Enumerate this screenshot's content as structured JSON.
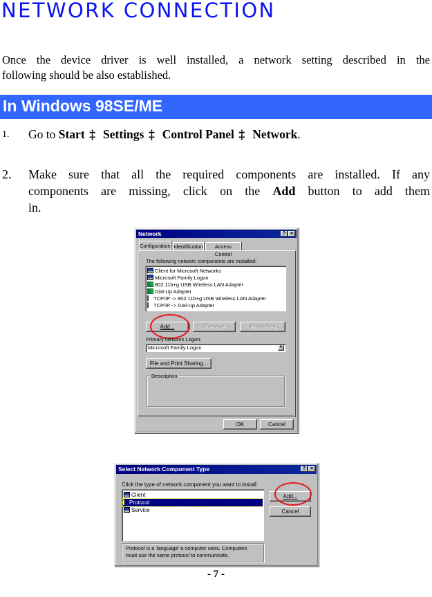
{
  "document": {
    "title": "NETWORK CONNECTION",
    "intro_line1": "Once the device driver is well installed, a network setting described in the",
    "intro_line2": "following should be also established.",
    "section_title": "In Windows 98SE/ME",
    "step1": {
      "number": "1.",
      "prefix": "Go to ",
      "path": [
        "Start",
        "Settings",
        "Control Panel",
        "Network"
      ],
      "arrow_glyph": "‡",
      "suffix": "."
    },
    "step2": {
      "number": "2.",
      "line1": "Make sure that all the required components are installed. If any",
      "line2_pre": "components are missing, click on the ",
      "line2_bold": "Add",
      "line2_post": " button to add them",
      "line3": "in."
    },
    "page_number": "- 7 -"
  },
  "network_dialog": {
    "title": "Network",
    "help_btn": "?",
    "close_btn": "×",
    "tabs": [
      "Configuration",
      "Identification",
      "Access Control"
    ],
    "active_tab": "Configuration",
    "list_label": "The following network components are installed:",
    "components": [
      {
        "icon": "client-icon",
        "label": "Client for Microsoft Networks"
      },
      {
        "icon": "client-icon",
        "label": "Microsoft Family Logon"
      },
      {
        "icon": "adapter-icon",
        "label": "802.11b+g USB Wireless LAN Adapter"
      },
      {
        "icon": "adapter-icon",
        "label": "Dial-Up Adapter"
      },
      {
        "icon": "protocol-icon",
        "label": "TCP/IP -> 802.11b+g USB Wireless LAN Adapter"
      },
      {
        "icon": "protocol-icon",
        "label": "TCP/IP -> Dial-Up Adapter"
      }
    ],
    "buttons": {
      "add": "Add...",
      "remove": "Remove",
      "properties": "Properties"
    },
    "primary_logon_label": "Primary Network Logon:",
    "primary_logon_value": "Microsoft Family Logon",
    "file_print_sharing": "File and Print Sharing...",
    "description_label": "Description",
    "ok": "OK",
    "cancel": "Cancel"
  },
  "component_type_dialog": {
    "title": "Select Network Component Type",
    "help_btn": "?",
    "close_btn": "×",
    "prompt": "Click the type of network component you want to install:",
    "types": [
      {
        "icon": "client-icon",
        "label": "Client"
      },
      {
        "icon": "protocol-icon",
        "label": "Protocol"
      },
      {
        "icon": "service-icon",
        "label": "Service"
      }
    ],
    "selected": "Protocol",
    "add": "Add...",
    "cancel": "Cancel",
    "description_line1": "Protocol is a 'language' a computer uses. Computers",
    "description_line2": "must use the same protocol to communicate."
  },
  "colors": {
    "title_blue": "#0a14f0",
    "section_bar": "#3366ff",
    "highlight_ellipse": "#e4141b",
    "win_titlebar": "#000080",
    "win_face": "#c0c0c0"
  }
}
